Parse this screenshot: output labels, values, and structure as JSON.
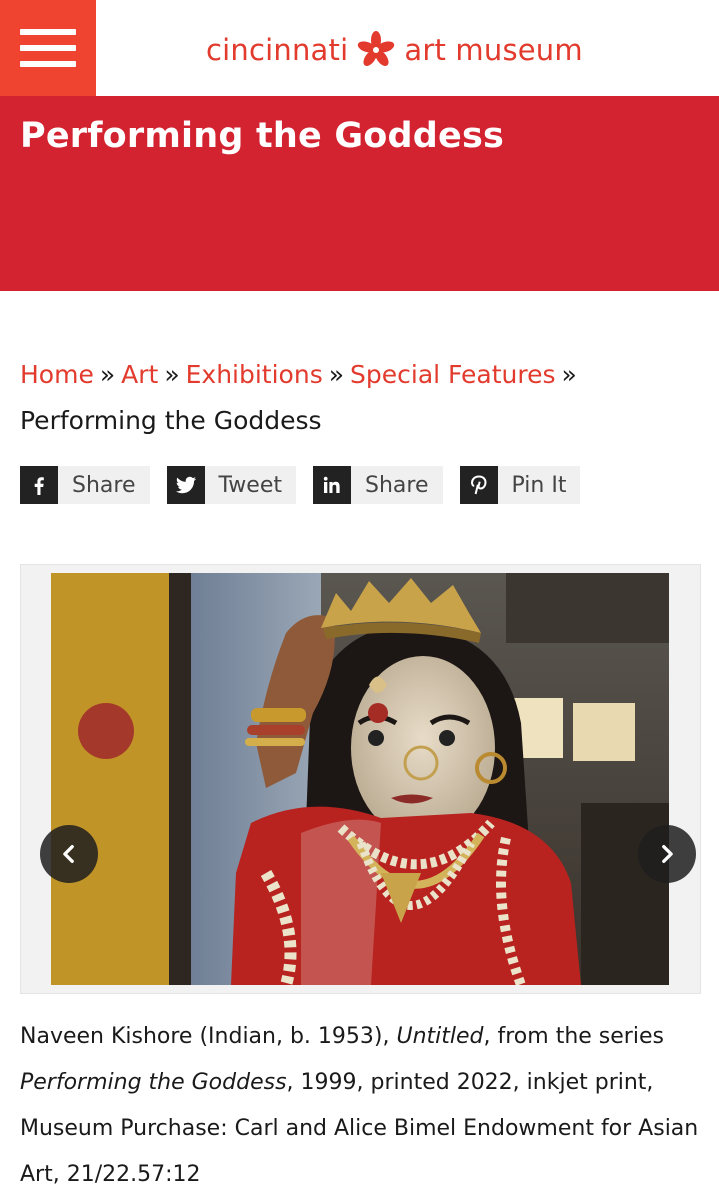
{
  "header": {
    "menu_icon": "hamburger-menu-icon",
    "logo_left": "cincinnati",
    "logo_right": "art museum",
    "logo_icon": "asterisk-flower-logo-icon",
    "brand_color": "#e23b2e"
  },
  "title_band": {
    "title": "Performing the Goddess",
    "background": "#d32331"
  },
  "breadcrumb": {
    "items": [
      "Home",
      "Art",
      "Exhibitions",
      "Special Features"
    ],
    "separator": "»",
    "current": "Performing the Goddess"
  },
  "share_buttons": [
    {
      "icon": "facebook-icon",
      "label": "Share"
    },
    {
      "icon": "twitter-icon",
      "label": "Tweet"
    },
    {
      "icon": "linkedin-icon",
      "label": "Share"
    },
    {
      "icon": "pinterest-icon",
      "label": "Pin It"
    }
  ],
  "slideshow": {
    "prev_icon": "chevron-left-icon",
    "next_icon": "chevron-right-icon"
  },
  "caption": {
    "artist": "Naveen Kishore (Indian, b. 1953), ",
    "title_italic": "Untitled",
    "from_series": ", from the series ",
    "series_italic": "Performing the Goddess",
    "details": ", 1999, printed 2022, inkjet print, Museum Purchase: Carl and Alice Bimel Endowment for Asian Art, 21/22.57:12"
  }
}
